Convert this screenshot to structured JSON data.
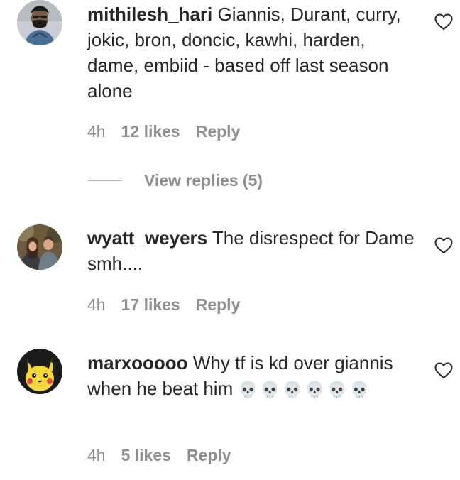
{
  "comments": [
    {
      "username": "mithilesh_hari",
      "text": "Giannis, Durant, curry, jokic, bron, doncic, kawhi, harden, dame, embiid - based off last season alone",
      "time": "4h",
      "likes": "12 likes",
      "reply": "Reply",
      "view_replies": "View replies (5)",
      "avatar_icon": "user-avatar-masked-man"
    },
    {
      "username": "wyatt_weyers",
      "text": "The disrespect for Dame smh....",
      "time": "4h",
      "likes": "17 likes",
      "reply": "Reply",
      "avatar_icon": "user-avatar-couple-photo"
    },
    {
      "username": "marxooooo",
      "text": "Why tf is kd over giannis when he beat him",
      "emoji": "💀💀💀💀💀💀",
      "time": "4h",
      "likes": "5 likes",
      "reply": "Reply",
      "avatar_icon": "user-avatar-pikachu"
    }
  ],
  "colors": {
    "text": "#262626",
    "meta": "#8e8e8e",
    "divider": "#b5b5b5",
    "heart_stroke": "#262626"
  },
  "icons": {
    "like": "heart-outline-icon"
  }
}
